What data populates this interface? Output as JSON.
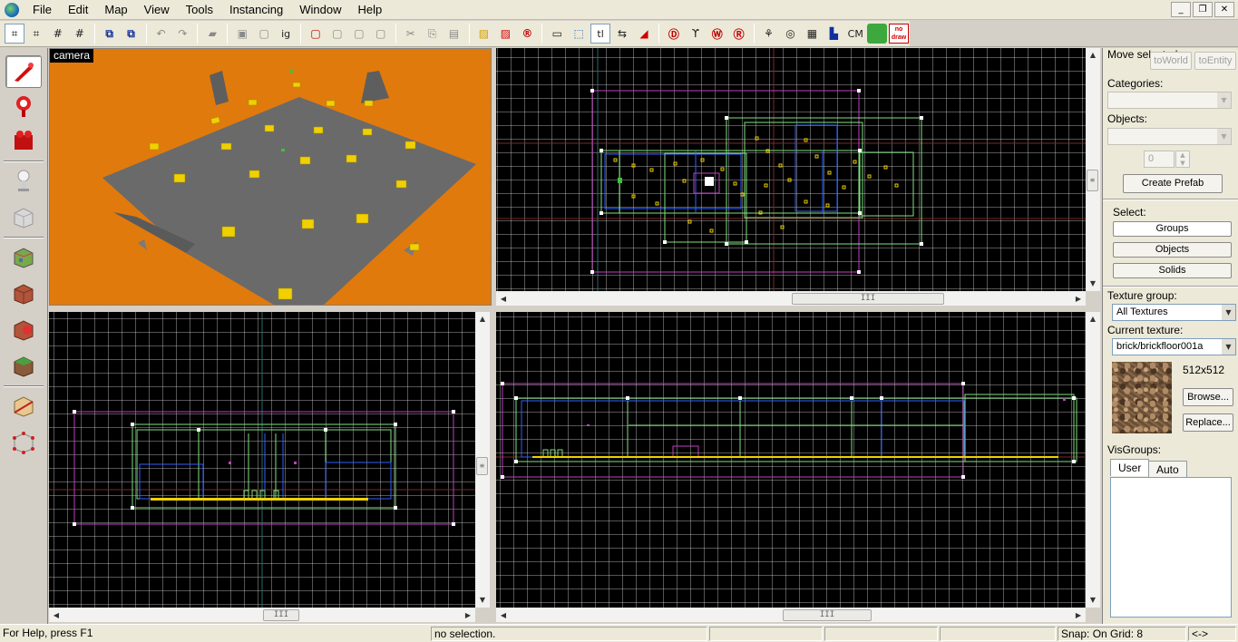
{
  "menu": [
    "File",
    "Edit",
    "Map",
    "View",
    "Tools",
    "Instancing",
    "Window",
    "Help"
  ],
  "window_controls": [
    "_",
    "❐",
    "✕"
  ],
  "toolbar": {
    "grid_buttons": [
      "⌗",
      "⌗",
      "#",
      "#"
    ],
    "text_buttons": {
      "texlock": "tl",
      "cordon": "CM",
      "nodraw": "no draw"
    }
  },
  "viewports": {
    "camera": {
      "label": "camera"
    }
  },
  "scrollbar_grip": "III",
  "side_panel": {
    "move_selected_label": "Move selected:",
    "to_world": "toWorld",
    "to_entity": "toEntity",
    "categories_label": "Categories:",
    "objects_label": "Objects:",
    "spin_value": "0",
    "create_prefab": "Create Prefab",
    "select_label": "Select:",
    "select_groups": "Groups",
    "select_objects": "Objects",
    "select_solids": "Solids",
    "texture_group_label": "Texture group:",
    "texture_group_value": "All Textures",
    "current_texture_label": "Current texture:",
    "current_texture_value": "brick/brickfloor001a",
    "texture_size": "512x512",
    "browse": "Browse...",
    "replace": "Replace...",
    "visgroups_label": "VisGroups:",
    "tab_user": "User",
    "tab_auto": "Auto"
  },
  "status": {
    "help": "For Help, press F1",
    "selection": "no selection.",
    "snap": "Snap: On Grid: 8",
    "arrows": "<->"
  },
  "colors": {
    "camera_bg": "#e07a0d",
    "floor": "#6a6a6a",
    "entity": "#f0d000",
    "brush_magenta": "#c040c0",
    "brush_green": "#80e080",
    "brush_blue": "#3060ff",
    "brush_white": "#ffffff"
  }
}
